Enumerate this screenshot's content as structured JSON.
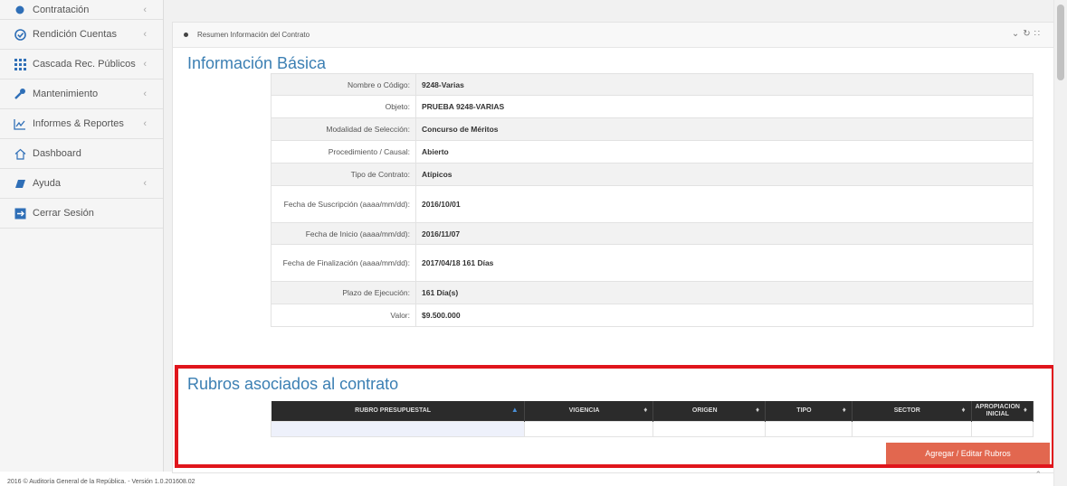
{
  "sidebar": {
    "items": [
      {
        "label": "Contratación",
        "icon": "circle-icon"
      },
      {
        "label": "Rendición Cuentas",
        "icon": "check-circle-icon"
      },
      {
        "label": "Cascada Rec. Públicos",
        "icon": "grid-icon"
      },
      {
        "label": "Mantenimiento",
        "icon": "wrench-icon"
      },
      {
        "label": "Informes & Reportes",
        "icon": "line-chart-icon"
      },
      {
        "label": "Dashboard",
        "icon": "home-icon"
      },
      {
        "label": "Ayuda",
        "icon": "book-icon"
      },
      {
        "label": "Cerrar Sesión",
        "icon": "logout-icon"
      }
    ]
  },
  "panel": {
    "header": "Resumen Información del Contrato"
  },
  "basic": {
    "title": "Información Básica",
    "rows": [
      {
        "label": "Nombre o Código:",
        "value": "9248-Varias"
      },
      {
        "label": "Objeto:",
        "value": "PRUEBA 9248-VARIAS"
      },
      {
        "label": "Modalidad de Selección:",
        "value": "Concurso de Méritos"
      },
      {
        "label": "Procedimiento / Causal:",
        "value": "Abierto"
      },
      {
        "label": "Tipo de Contrato:",
        "value": "Atípicos"
      },
      {
        "label": "Fecha de Suscripción (aaaa/mm/dd):",
        "value": "2016/10/01"
      },
      {
        "label": "Fecha de Inicio (aaaa/mm/dd):",
        "value": "2016/11/07"
      },
      {
        "label": "Fecha de Finalización (aaaa/mm/dd):",
        "value": "2017/04/18 161 Días"
      },
      {
        "label": "Plazo de Ejecución:",
        "value": "161 Día(s)"
      },
      {
        "label": "Valor:",
        "value": "$9.500.000"
      }
    ]
  },
  "rubros": {
    "title": "Rubros asociados al contrato",
    "columns": [
      "RUBRO PRESUPUESTAL",
      "VIGENCIA",
      "ORIGEN",
      "TIPO",
      "SECTOR",
      "APROPIACION INICIAL"
    ],
    "button": "Agregar / Editar Rubros"
  },
  "footer": "2016 © Auditoría General de la República. - Versión 1.0.201608.02"
}
